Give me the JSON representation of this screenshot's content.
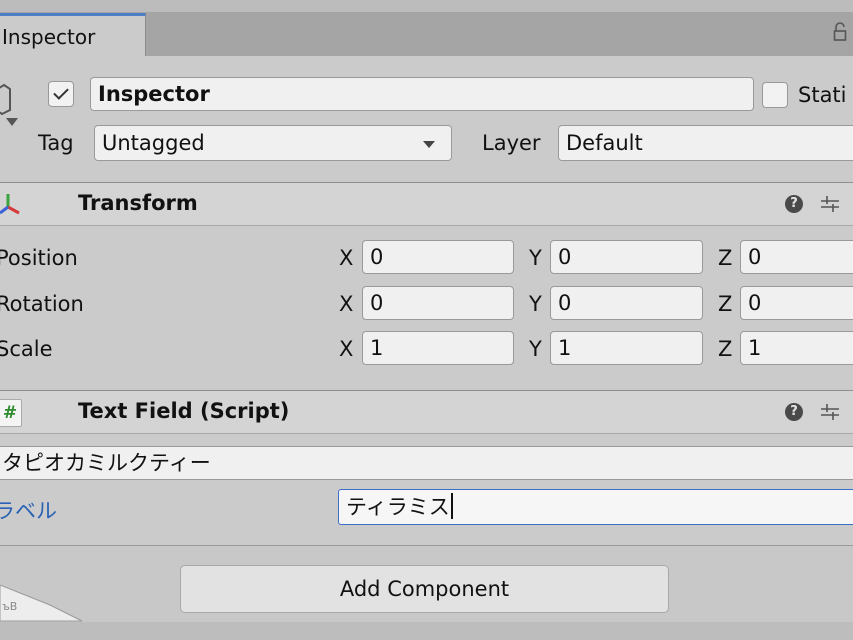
{
  "tab": {
    "label": "Inspector"
  },
  "game_object": {
    "active": true,
    "name": "Inspector",
    "static_label": "Stati",
    "tag_label": "Tag",
    "tag_value": "Untagged",
    "layer_label": "Layer",
    "layer_value": "Default"
  },
  "transform": {
    "title": "Transform",
    "rows": [
      {
        "label": "Position",
        "x": "0",
        "y": "0",
        "z": "0"
      },
      {
        "label": "Rotation",
        "x": "0",
        "y": "0",
        "z": "0"
      },
      {
        "label": "Scale",
        "x": "1",
        "y": "1",
        "z": "1"
      }
    ],
    "axis": {
      "x": "X",
      "y": "Y",
      "z": "Z"
    }
  },
  "text_field_component": {
    "title": "Text Field (Script)",
    "script_icon": "#",
    "text_value": "タピオカミルクティー",
    "label_name": "ラベル",
    "label_value": "ティラミス",
    "label_color": "#2a62b5"
  },
  "add_component_label": "Add Component",
  "corner_label": "ъВ"
}
